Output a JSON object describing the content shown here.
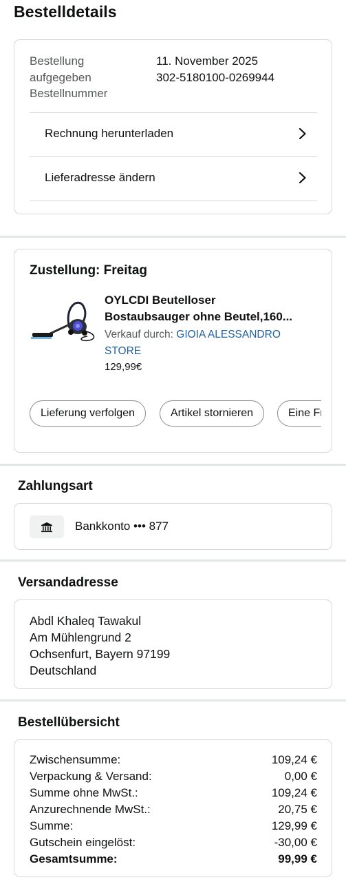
{
  "page": {
    "title": "Bestelldetails"
  },
  "order": {
    "labels": [
      "Bestellung",
      "aufgegeben",
      "Bestellnummer"
    ],
    "date": "11. November 2025",
    "number": "302-5180100-0269944",
    "links": [
      {
        "label": "Rechnung herunterladen",
        "icon": "chevron-right-icon"
      },
      {
        "label": "Lieferadresse ändern",
        "icon": "chevron-right-icon"
      }
    ]
  },
  "delivery": {
    "title": "Zustellung: Freitag",
    "product": {
      "name_line1": "OYLCDI Beutelloser",
      "name_line2": "Bostaubsauger ohne Beutel,160...",
      "seller_prefix": "Verkauf durch: ",
      "seller_line1": "GIOIA ALESSANDRO",
      "seller_line2": "STORE",
      "price": "129,99€"
    },
    "actions": [
      "Lieferung verfolgen",
      "Artikel stornieren",
      "Eine Fr"
    ]
  },
  "payment": {
    "title": "Zahlungsart",
    "method": "Bankkonto ••• 877",
    "icon": "bank-icon"
  },
  "shipping": {
    "title": "Versandadresse",
    "lines": [
      "Abdl Khaleq Tawakul",
      "Am Mühlengrund 2",
      "Ochsenfurt, Bayern 97199",
      "Deutschland"
    ]
  },
  "summary": {
    "title": "Bestellübersicht",
    "rows": [
      {
        "label": "Zwischensumme:",
        "value": "109,24 €"
      },
      {
        "label": "Verpackung & Versand:",
        "value": "0,00 €"
      },
      {
        "label": "Summe ohne MwSt.:",
        "value": "109,24 €"
      },
      {
        "label": "Anzurechnende MwSt.:",
        "value": "20,75 €"
      },
      {
        "label": "Summe:",
        "value": "129,99 €"
      },
      {
        "label": "Gutschein eingelöst:",
        "value": "-30,00 €"
      }
    ],
    "total": {
      "label": "Gesamtsumme:",
      "value": "99,99 €"
    }
  },
  "colors": {
    "link": "#2162a1",
    "border": "#d5d9d9",
    "divider": "#e3e6e6",
    "muted": "#565959"
  }
}
